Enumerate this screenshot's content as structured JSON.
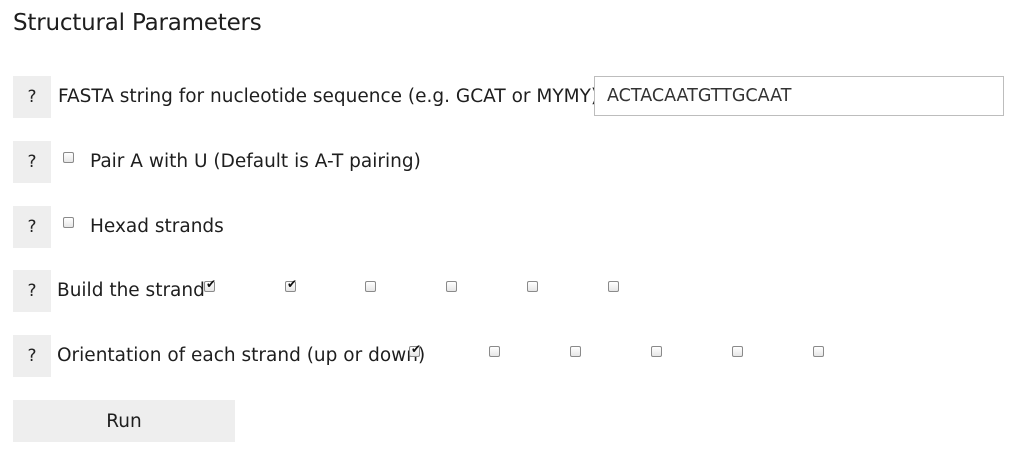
{
  "page": {
    "title": "Structural Parameters"
  },
  "help_label": "?",
  "fasta": {
    "label": "FASTA string for nucleotide sequence (e.g. GCAT or MYMY)",
    "value": "ACTACAATGTTGCAAT"
  },
  "pair_au": {
    "label": "Pair A with U (Default is A-T pairing)",
    "checked": false
  },
  "hexad": {
    "label": "Hexad strands",
    "checked": false
  },
  "build_strand": {
    "label": "Build the strand",
    "checks": [
      true,
      true,
      false,
      false,
      false,
      false
    ]
  },
  "orientation": {
    "label": "Orientation of each strand (up or down)",
    "checks": [
      true,
      false,
      false,
      false,
      false,
      false
    ]
  },
  "run": {
    "label": "Run"
  },
  "check_glyph": "✔"
}
